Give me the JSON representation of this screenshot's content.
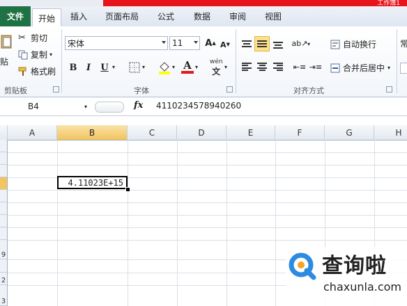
{
  "window": {
    "title": "工作簿1"
  },
  "tabs": [
    {
      "label": "文件"
    },
    {
      "label": "开始"
    },
    {
      "label": "插入"
    },
    {
      "label": "页面布局"
    },
    {
      "label": "公式"
    },
    {
      "label": "数据"
    },
    {
      "label": "审阅"
    },
    {
      "label": "视图"
    }
  ],
  "clipboard": {
    "paste_label": "贴",
    "cut_label": "剪切",
    "copy_label": "复制",
    "format_painter_label": "格式刷",
    "group_label": "剪贴板"
  },
  "font": {
    "name": "宋体",
    "size": "11",
    "grow_label": "A",
    "shrink_label": "A",
    "bold_label": "B",
    "italic_label": "I",
    "underline_label": "U",
    "font_color_label": "A",
    "phonetic_label": "wén",
    "group_label": "字体"
  },
  "alignment": {
    "wrap_text_label": "自动换行",
    "merge_center_label": "合并后居中",
    "group_label": "对齐方式"
  },
  "number": {
    "partial_label": "常"
  },
  "formula_bar": {
    "name_box": "B4",
    "fx_label": "fx",
    "content": "4110234578940260"
  },
  "columns": [
    "A",
    "B",
    "C",
    "D",
    "E",
    "F",
    "G",
    "H"
  ],
  "row_numbers": [
    "",
    "",
    "",
    "",
    "",
    "",
    "",
    "",
    "9",
    "",
    "2",
    "3"
  ],
  "cells": {
    "B4": "4.11023E+15"
  },
  "watermark": {
    "cn": "查询啦",
    "en": "chaxunla.com"
  },
  "colors": {
    "file_tab": "#1f7244",
    "title_bar": "#e8141b",
    "selection_header": "#f2c35d",
    "watermark_accent": "#2d8be0"
  }
}
